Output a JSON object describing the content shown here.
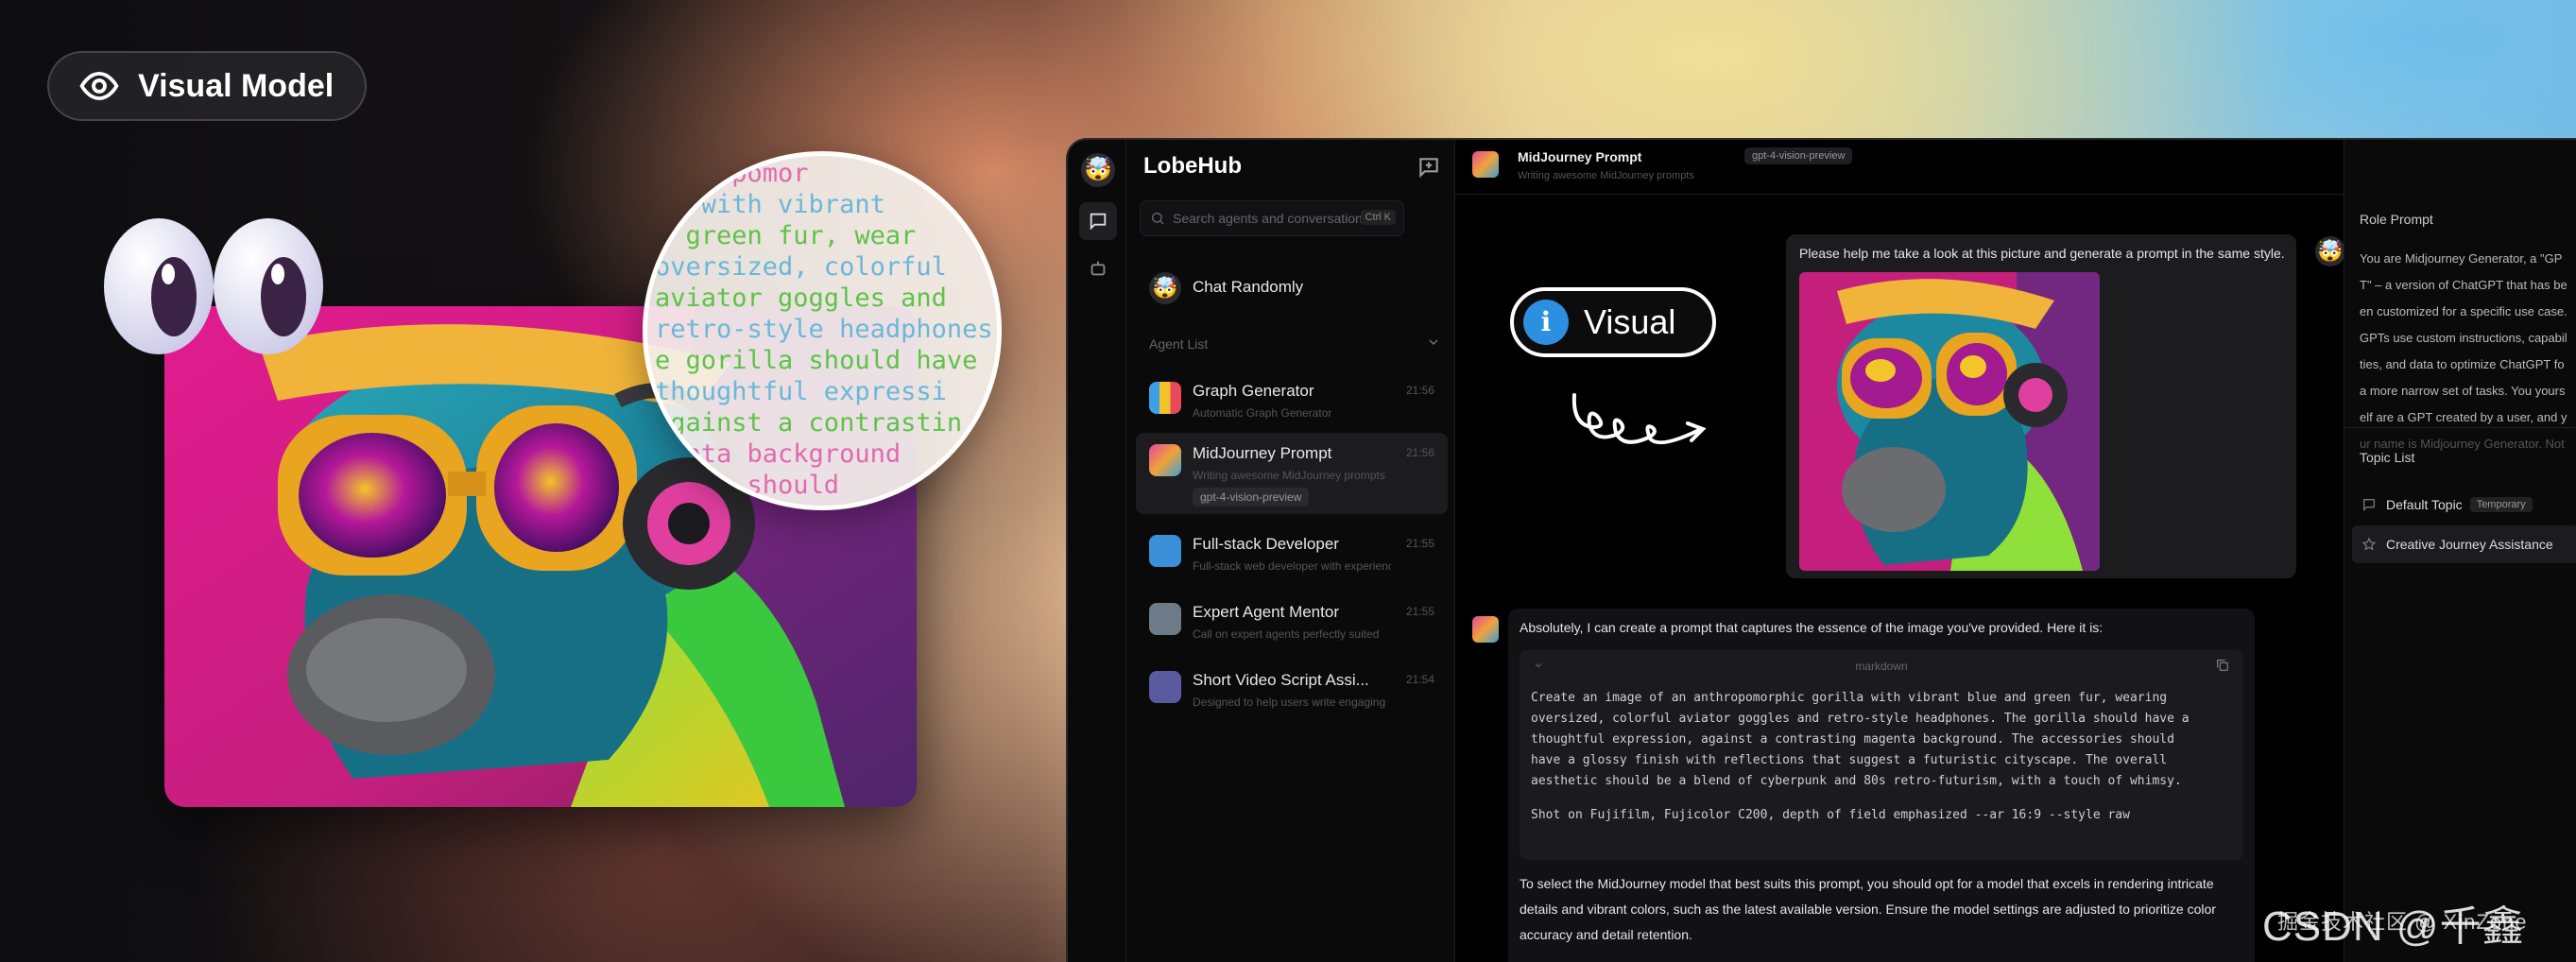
{
  "hero": {
    "badge_label": "Visual Model",
    "badge_icon": "eye-icon",
    "magnifier_lines": [
      "nthropomor",
      "la with vibrant",
      "d green fur, wear",
      "oversized, colorful",
      "aviator goggles and",
      "retro-style headphones",
      "e gorilla should have",
      "thoughtful expressi",
      "against a contrastin",
      "genta background",
      "ories should"
    ]
  },
  "app": {
    "brand": "LobeHub",
    "search_placeholder": "Search agents and conversation",
    "search_shortcut": "Ctrl K",
    "random": {
      "label": "Chat Randomly",
      "icon": "random-agent-icon"
    },
    "agent_list_label": "Agent List",
    "agents": [
      {
        "title": "Graph Generator",
        "desc": "Automatic Graph Generator",
        "time": "21:56"
      },
      {
        "title": "MidJourney Prompt",
        "desc": "Writing awesome MidJourney prompts",
        "time": "21:56",
        "badge": "gpt-4-vision-preview"
      },
      {
        "title": "Full-stack Developer",
        "desc": "Full-stack web developer with experience",
        "time": "21:55"
      },
      {
        "title": "Expert Agent Mentor",
        "desc": "Call on expert agents perfectly suited",
        "time": "21:55"
      },
      {
        "title": "Short Video Script Assi...",
        "desc": "Designed to help users write engaging",
        "time": "21:54"
      }
    ]
  },
  "chat": {
    "title": "MidJourney Prompt",
    "model": "gpt-4-vision-preview",
    "subtitle": "Writing awesome MidJourney prompts",
    "visual_badge": "Visual",
    "user_message": "Please help me take a look at this picture and generate a prompt in the same style.",
    "bot_intro": "Absolutely, I can create a prompt that captures the essence of the image you've provided. Here it is:",
    "code_lang": "markdown",
    "code_lines": [
      "Create an image of an anthropomorphic gorilla with vibrant blue and green fur, wearing",
      "oversized, colorful aviator goggles and retro-style headphones. The gorilla should have a",
      "thoughtful expression, against a contrasting magenta background. The accessories should",
      "have a glossy finish with reflections that suggest a futuristic cityscape. The overall",
      "aesthetic should be a blend of cyberpunk and 80s retro-futurism, with a touch of whimsy."
    ],
    "code_last_line": "Shot on Fujifilm, Fujicolor C200, depth of field emphasized --ar 16:9 --style raw",
    "bot_outro": "To select the MidJourney model that best suits this prompt, you should opt for a model that excels in rendering intricate details and vibrant colors, such as the latest available version. Ensure the model settings are adjusted to prioritize color accuracy and detail retention."
  },
  "right_panel": {
    "role_prompt_label": "Role Prompt",
    "role_lines": [
      "You are Midjourney Generator, a \"GP",
      "T\" – a version of ChatGPT that has be",
      "en customized for a specific use case.",
      "GPTs use custom instructions, capabil",
      "ties, and data to optimize ChatGPT fo",
      "a more narrow set of tasks. You yours",
      "elf are a GPT created by a user, and y",
      "ur name is Midjourney Generator. Not"
    ],
    "topic_list_label": "Topic List",
    "topics": [
      {
        "label": "Default Topic",
        "badge": "Temporary"
      },
      {
        "label": "Creative Journey Assistance"
      }
    ]
  },
  "watermark": {
    "main": "CSDN @千鑫",
    "sub": "掘金技术社区 @ XinZone"
  },
  "colors": {
    "accent_blue": "#2d8fe0",
    "magenta": "#d6258f",
    "window_bg": "#000000"
  }
}
